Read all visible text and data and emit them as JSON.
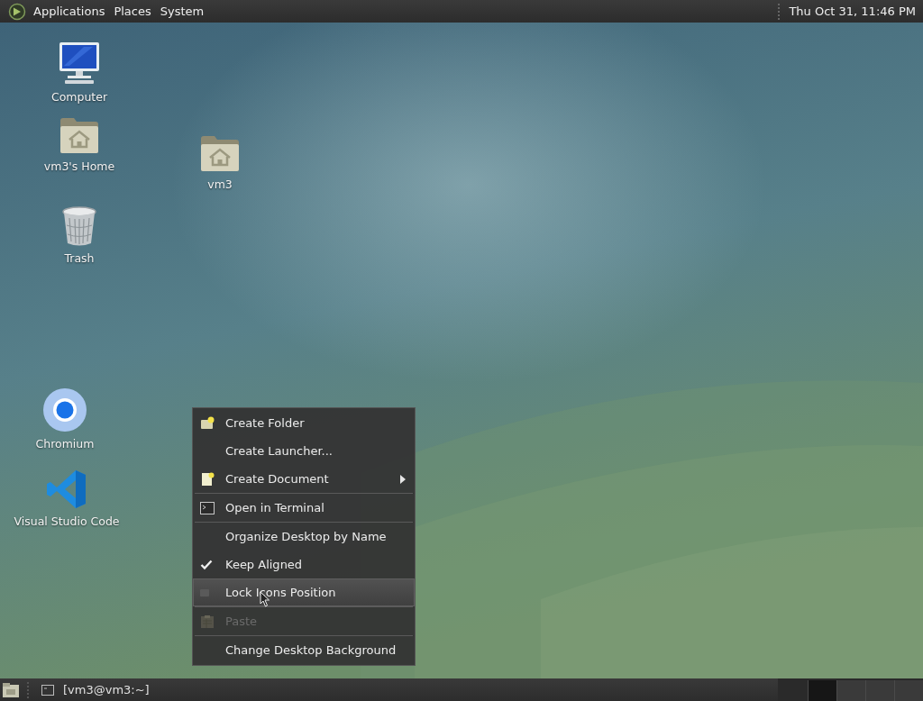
{
  "top_panel": {
    "menus": [
      "Applications",
      "Places",
      "System"
    ],
    "clock": "Thu Oct 31, 11:46 PM"
  },
  "desktop_icons": [
    {
      "label": "Computer",
      "kind": "computer"
    },
    {
      "label": "vm3's Home",
      "kind": "home"
    },
    {
      "label": "vm3",
      "kind": "home"
    },
    {
      "label": "Trash",
      "kind": "trash"
    },
    {
      "label": "Chromium",
      "kind": "browser"
    },
    {
      "label": "Visual Studio Code",
      "kind": "editor"
    }
  ],
  "context_menu": {
    "sections": [
      [
        {
          "label": "Create Folder",
          "kind": "folder",
          "submenu": false,
          "disabled": false,
          "selected": false
        },
        {
          "label": "Create Launcher...",
          "kind": "plain",
          "submenu": false,
          "disabled": false,
          "selected": false
        },
        {
          "label": "Create Document",
          "kind": "document",
          "submenu": true,
          "disabled": false,
          "selected": false
        }
      ],
      [
        {
          "label": "Open in Terminal",
          "kind": "terminal",
          "submenu": false,
          "disabled": false,
          "selected": false
        }
      ],
      [
        {
          "label": "Organize Desktop by Name",
          "kind": "plain",
          "submenu": false,
          "disabled": false,
          "selected": false
        },
        {
          "label": "Keep Aligned",
          "kind": "check",
          "checked": true,
          "submenu": false,
          "disabled": false,
          "selected": false
        },
        {
          "label": "Lock Icons Position",
          "kind": "check",
          "checked": false,
          "submenu": false,
          "disabled": false,
          "selected": true
        }
      ],
      [
        {
          "label": "Paste",
          "kind": "paste",
          "submenu": false,
          "disabled": true,
          "selected": false
        }
      ],
      [
        {
          "label": "Change Desktop Background",
          "kind": "plain",
          "submenu": false,
          "disabled": false,
          "selected": false
        }
      ]
    ]
  },
  "bottom_panel": {
    "tasks": [
      {
        "label": "[vm3@vm3:~]",
        "selected": false
      }
    ],
    "workspaces": [
      {
        "selected": true
      },
      {
        "selected": false
      },
      {
        "selected": false
      },
      {
        "selected": false
      }
    ]
  }
}
